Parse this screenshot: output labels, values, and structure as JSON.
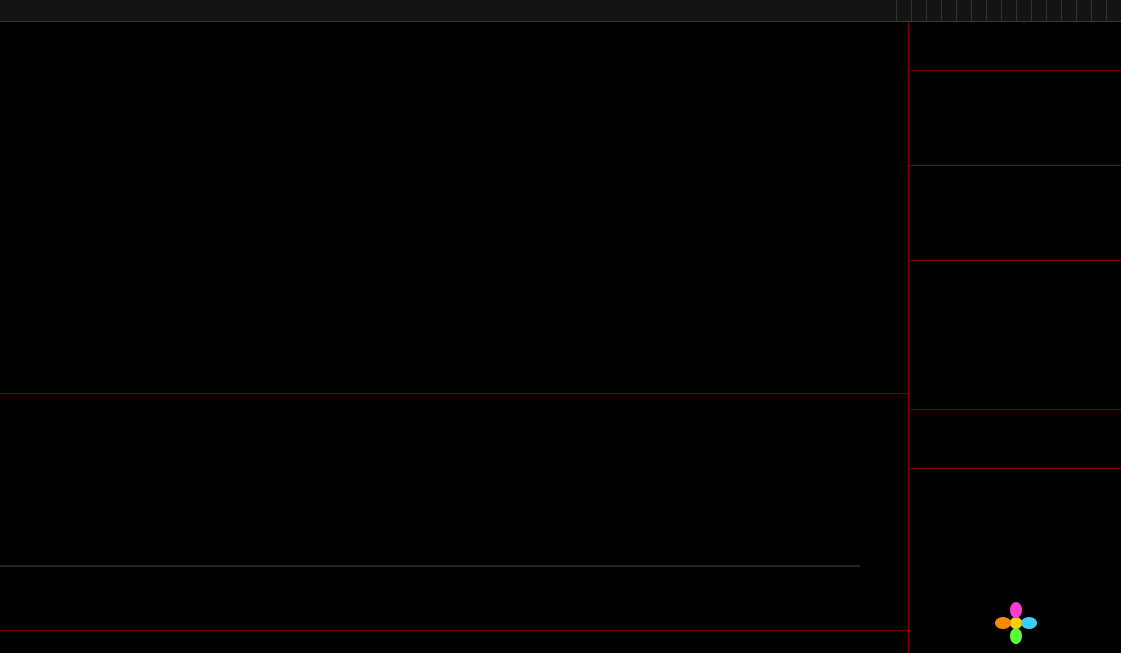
{
  "toolbar": {
    "left_tabs": [
      "",
      "",
      "",
      "",
      "",
      "",
      ""
    ],
    "right_tabs": [
      "",
      "",
      "",
      "",
      "",
      "",
      "",
      "",
      "",
      "",
      "",
      "",
      "",
      "",
      ""
    ]
  },
  "main_panel": {
    "header": "",
    "concept_line_1": "",
    "concept_line_2": ""
  },
  "indicator_panel": {
    "header": ""
  },
  "dates": [
    "",
    "",
    "",
    "",
    "",
    "",
    "",
    ""
  ],
  "side": {
    "stock_name": "",
    "stock_code": "",
    "price": "",
    "change": "",
    "change_pct": "",
    "book": [
      {
        "label": "",
        "price": "",
        "vol": ""
      },
      {
        "label": "",
        "price": "",
        "vol": ""
      },
      {
        "label": "",
        "price": "",
        "vol": ""
      },
      {
        "label": "",
        "price": "",
        "vol": ""
      },
      {
        "label": "",
        "price": "",
        "vol": ""
      },
      {
        "label": "",
        "price": "",
        "vol": ""
      },
      {
        "label": "",
        "price": "",
        "vol": ""
      },
      {
        "label": "",
        "price": "",
        "vol": ""
      },
      {
        "label": "",
        "price": "",
        "vol": ""
      },
      {
        "label": "",
        "price": "",
        "vol": ""
      }
    ],
    "stats": [
      {
        "k1": "",
        "v1": "",
        "k2": "",
        "v2": ""
      },
      {
        "k1": "",
        "v1": "",
        "k2": "",
        "v2": ""
      },
      {
        "k1": "",
        "v1": "",
        "k2": "",
        "v2": ""
      },
      {
        "k1": "",
        "v1": "",
        "k2": "",
        "v2": ""
      },
      {
        "k1": "",
        "v1": "",
        "k2": "",
        "v2": ""
      },
      {
        "k1": "",
        "v1": "",
        "k2": "",
        "v2": ""
      },
      {
        "k1": "",
        "v1": "",
        "k2": "",
        "v2": ""
      },
      {
        "k1": "",
        "v1": "",
        "k2": "",
        "v2": ""
      }
    ],
    "status_lines": [
      "",
      "",
      ""
    ],
    "ticks": [
      {
        "time": "",
        "price": "",
        "vol": "",
        "side": ""
      },
      {
        "time": "",
        "price": "",
        "vol": "",
        "side": ""
      },
      {
        "time": "",
        "price": "",
        "vol": "",
        "side": ""
      },
      {
        "time": "",
        "price": "",
        "vol": "",
        "side": ""
      },
      {
        "time": "",
        "price": "",
        "vol": "",
        "side": ""
      }
    ]
  },
  "colors": {
    "up": "#ff3b3b",
    "down": "#00e5ee",
    "accent": "#ff00ff",
    "ma": "#ffff00",
    "frame": "#7a0000"
  }
}
